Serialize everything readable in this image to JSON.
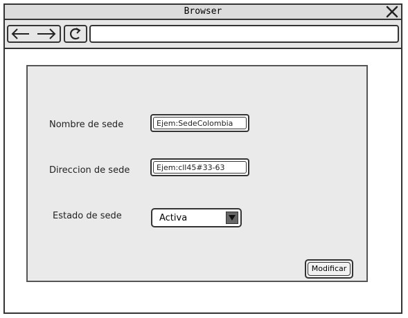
{
  "window": {
    "title": "Browser"
  },
  "toolbar": {
    "url": ""
  },
  "form": {
    "nombre_label": "Nombre de sede",
    "nombre_value": "Ejem:SedeColombia",
    "direccion_label": "Direccion de sede",
    "direccion_value": "Ejem:cll45#33-63",
    "estado_label": "Estado de sede",
    "estado_value": "Activa",
    "submit_label": "Modificar"
  }
}
